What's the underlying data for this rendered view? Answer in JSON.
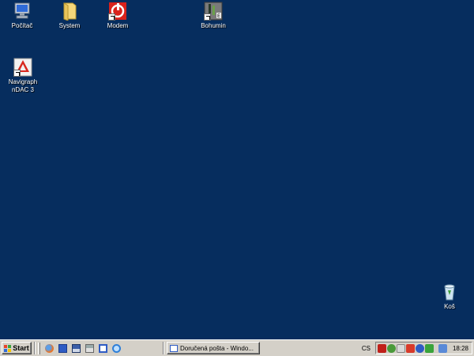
{
  "desktop": {
    "icons": [
      {
        "label": "Počítač"
      },
      {
        "label": "System"
      },
      {
        "label": "Modem"
      },
      {
        "label": "Bohumin"
      },
      {
        "label": "Navigraph\nnDAC 3"
      },
      {
        "label": "Koš"
      }
    ],
    "background_color": "#062d5e"
  },
  "taskbar": {
    "start_label": "Start",
    "quick_launch": [
      "firefox-icon",
      "outlook-icon",
      "save-icon",
      "printer-icon",
      "window-icon",
      "internet-explorer-icon"
    ],
    "task_button_label": "Doručená pošta - Windo...",
    "language": "CS",
    "tray_icons": [
      "acrobat-icon",
      "network-icon",
      "volume-icon",
      "antivirus-icon",
      "bluetooth-icon",
      "shield-icon",
      "display-icon"
    ],
    "clock": "18:28"
  }
}
